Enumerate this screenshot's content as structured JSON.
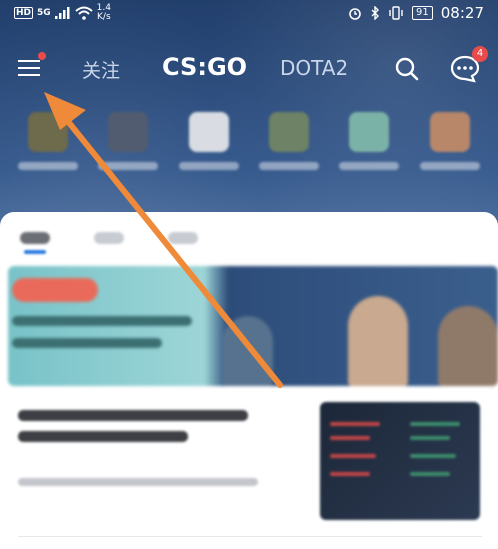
{
  "status_bar": {
    "hd": "HD",
    "network": "5G",
    "speed_value": "1.4",
    "speed_unit": "K/s",
    "battery": "91",
    "time": "08:27"
  },
  "nav": {
    "tabs": [
      {
        "label": "关注"
      },
      {
        "label": "CS:GO"
      },
      {
        "label": "DOTA2"
      }
    ],
    "active_tab": "CS:GO",
    "message_count": "4"
  },
  "colors": {
    "header_bg": "#2a4b7c",
    "accent_arrow": "#ee8a3a",
    "badge_red": "#e94b4b"
  },
  "icons": [
    "menu-icon",
    "search-icon",
    "message-icon",
    "alarm-icon",
    "bluetooth-icon",
    "vibrate-icon",
    "battery-icon",
    "wifi-icon",
    "signal-icon"
  ]
}
